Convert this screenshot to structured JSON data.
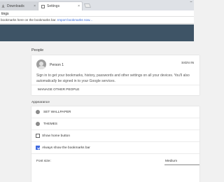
{
  "tabs": [
    {
      "label": "Downloads",
      "active": false
    },
    {
      "label": "Settings",
      "active": true
    }
  ],
  "window_controls": [
    "–",
    "□",
    "×"
  ],
  "omnibox": {
    "text": "tings"
  },
  "bookmarks_bar": {
    "message": "bookmarks here on the bookmarks bar.",
    "link": "Import bookmarks now..."
  },
  "colors": {
    "header": "#3e5466",
    "accent": "#3f6ae0"
  },
  "people": {
    "section_title": "People",
    "person_name": "Person 1",
    "sign_in_label": "SIGN IN",
    "sign_in_text": "Sign in to get your bookmarks, history, passwords and other settings on all your devices. You'll also automatically be signed in to your Google services.",
    "manage_label": "MANAGE OTHER PEOPLE"
  },
  "appearance": {
    "section_title": "Appearance",
    "wallpaper_label": "SET WALLPAPER",
    "themes_label": "THEMES",
    "home_button_label": "Show home button",
    "home_button_checked": false,
    "bookmarks_bar_label": "Always show the bookmarks bar",
    "bookmarks_bar_checked": true,
    "font_size_label": "Font size:",
    "font_size_value": "Medium"
  }
}
